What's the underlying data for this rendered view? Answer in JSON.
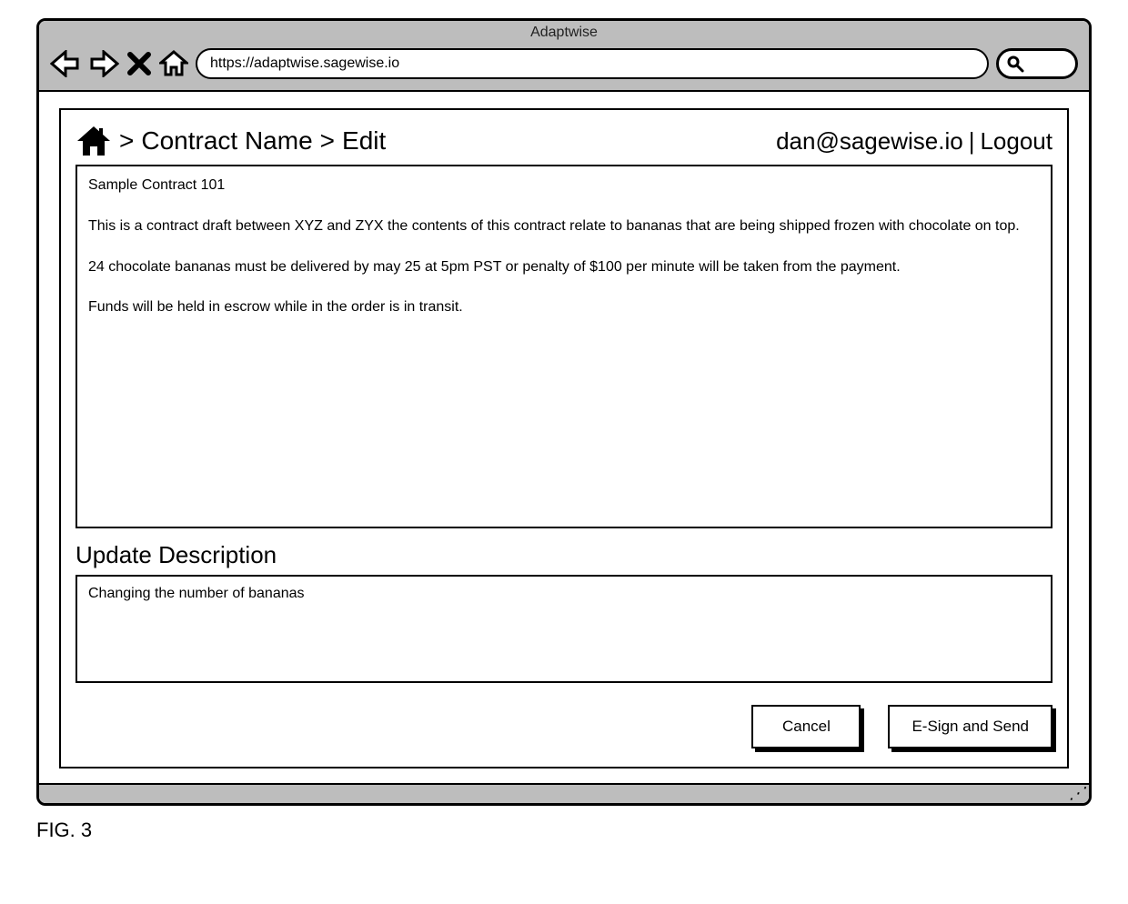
{
  "window": {
    "title": "Adaptwise",
    "url": "https://adaptwise.sagewise.io"
  },
  "breadcrumbs": {
    "segment1": "Contract Name",
    "segment2": "Edit"
  },
  "user": {
    "email": "dan@sagewise.io",
    "logout_label": "Logout"
  },
  "contract": {
    "body": "Sample Contract 101\n\nThis is a contract draft between XYZ and ZYX the contents of this contract relate to bananas that are being shipped frozen with chocolate on top.\n\n24 chocolate bananas must be delivered by may 25 at 5pm PST or penalty of $100 per minute will be taken from the payment.\n\nFunds will be held in escrow while in the order is in transit."
  },
  "update_section": {
    "title": "Update Description",
    "value": "Changing the number of bananas"
  },
  "buttons": {
    "cancel": "Cancel",
    "submit": "E-Sign and Send"
  },
  "figure_caption": "FIG. 3"
}
